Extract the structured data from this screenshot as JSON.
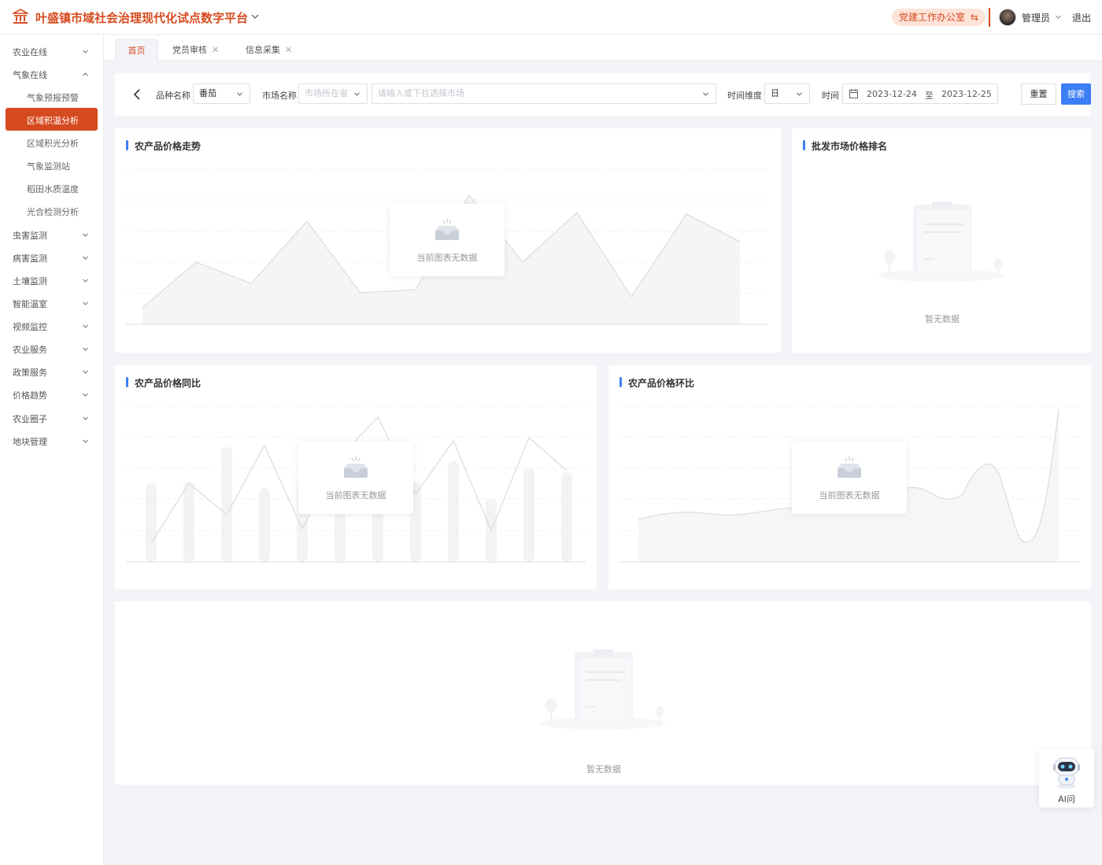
{
  "header": {
    "app_title": "叶盛镇市域社会治理现代化试点数字平台",
    "party_office_label": "党建工作办公室",
    "admin_name": "管理员",
    "logout_label": "退出",
    "brand_color": "#d64a1f"
  },
  "sidebar": {
    "items": [
      {
        "label": "农业在线"
      },
      {
        "label": "气象在线"
      },
      {
        "label": "气象预报预警"
      },
      {
        "label": "区域积温分析"
      },
      {
        "label": "区域积光分析"
      },
      {
        "label": "气象监测站"
      },
      {
        "label": "稻田水质温度"
      },
      {
        "label": "光合检测分析"
      },
      {
        "label": "虫害监测"
      },
      {
        "label": "病害监测"
      },
      {
        "label": "土壤监测"
      },
      {
        "label": "智能温室"
      },
      {
        "label": "视频监控"
      },
      {
        "label": "农业服务"
      },
      {
        "label": "政策服务"
      },
      {
        "label": "价格趋势"
      },
      {
        "label": "农业圈子"
      },
      {
        "label": "地块管理"
      }
    ]
  },
  "tabs": [
    {
      "label": "首页"
    },
    {
      "label": "党员审核"
    },
    {
      "label": "信息采集"
    }
  ],
  "filter": {
    "variety_label": "品种名称",
    "variety_value": "番茄",
    "market_label": "市场名称",
    "province_placeholder": "市场所在省",
    "market_placeholder": "请输入或下拉选择市场",
    "dimension_label": "时间维度",
    "dimension_value": "日",
    "time_label": "时间",
    "date_start": "2023-12-24",
    "date_sep": "至",
    "date_end": "2023-12-25",
    "reset_label": "重置",
    "search_label": "搜索",
    "search_color": "#3b7ef6"
  },
  "cards": {
    "price_trend": {
      "title": "农产品价格走势",
      "nodata": "当前图表无数据"
    },
    "market_rank": {
      "title": "批发市场价格排名",
      "empty": "暂无数据"
    },
    "yoy": {
      "title": "农产品价格同比",
      "nodata": "当前图表无数据"
    },
    "mom": {
      "title": "农产品价格环比",
      "nodata": "当前图表无数据"
    },
    "bottom": {
      "empty": "暂无数据"
    }
  },
  "ai": {
    "label": "AI问"
  }
}
